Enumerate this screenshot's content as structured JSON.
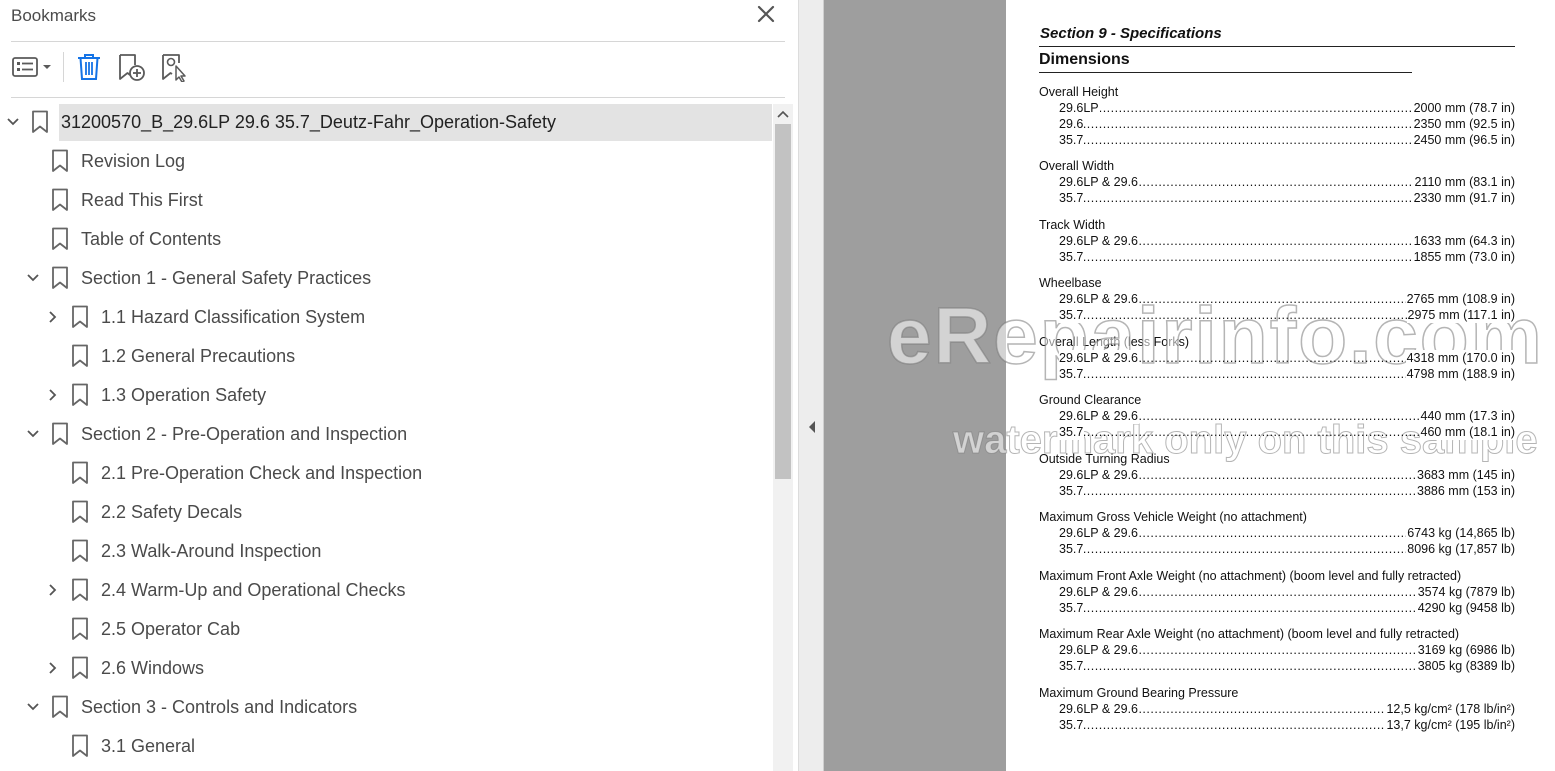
{
  "panel": {
    "title": "Bookmarks",
    "close_icon": "close-icon"
  },
  "toolbar": {
    "options_icon": "options-menu-icon",
    "delete_icon": "trash-icon",
    "new_bookmark_icon": "add-bookmark-icon",
    "bookmark_search_icon": "find-bookmark-icon"
  },
  "bookmarks": [
    {
      "label": "31200570_B_29.6LP 29.6 35.7_Deutz-Fahr_Operation-Safety",
      "level": 0,
      "chevron": "down",
      "selected": true
    },
    {
      "label": "Revision Log",
      "level": 1,
      "chevron": "none"
    },
    {
      "label": "Read This First",
      "level": 1,
      "chevron": "none"
    },
    {
      "label": "Table of Contents",
      "level": 1,
      "chevron": "none"
    },
    {
      "label": "Section 1 - General Safety Practices",
      "level": 1,
      "chevron": "down"
    },
    {
      "label": "1.1 Hazard Classification System",
      "level": 2,
      "chevron": "right"
    },
    {
      "label": "1.2 General Precautions",
      "level": 2,
      "chevron": "none"
    },
    {
      "label": "1.3 Operation Safety",
      "level": 2,
      "chevron": "right"
    },
    {
      "label": "Section 2 - Pre-Operation and Inspection",
      "level": 1,
      "chevron": "down"
    },
    {
      "label": "2.1 Pre-Operation Check and Inspection",
      "level": 2,
      "chevron": "none"
    },
    {
      "label": "2.2 Safety Decals",
      "level": 2,
      "chevron": "none"
    },
    {
      "label": "2.3 Walk-Around Inspection",
      "level": 2,
      "chevron": "none"
    },
    {
      "label": "2.4 Warm-Up and Operational Checks",
      "level": 2,
      "chevron": "right"
    },
    {
      "label": "2.5 Operator Cab",
      "level": 2,
      "chevron": "none"
    },
    {
      "label": "2.6 Windows",
      "level": 2,
      "chevron": "right"
    },
    {
      "label": "Section 3 - Controls and Indicators",
      "level": 1,
      "chevron": "down"
    },
    {
      "label": "3.1 General",
      "level": 2,
      "chevron": "none"
    }
  ],
  "document": {
    "section_title": "Section 9 - Specifications",
    "heading": "Dimensions",
    "groups": [
      {
        "title": "Overall Height",
        "rows": [
          {
            "model": "29.6LP",
            "value": "2000 mm (78.7 in)"
          },
          {
            "model": "29.6",
            "value": "2350 mm (92.5 in)"
          },
          {
            "model": "35.7",
            "value": "2450 mm (96.5 in)"
          }
        ]
      },
      {
        "title": "Overall Width",
        "rows": [
          {
            "model": "29.6LP & 29.6",
            "value": "2110 mm (83.1 in)"
          },
          {
            "model": "35.7",
            "value": "2330 mm (91.7 in)"
          }
        ]
      },
      {
        "title": "Track Width",
        "rows": [
          {
            "model": "29.6LP & 29.6",
            "value": "1633 mm (64.3 in)"
          },
          {
            "model": "35.7",
            "value": "1855 mm (73.0 in)"
          }
        ]
      },
      {
        "title": "Wheelbase",
        "rows": [
          {
            "model": "29.6LP & 29.6",
            "value": "2765 mm (108.9 in)"
          },
          {
            "model": "35.7",
            "value": "2975 mm (117.1 in)"
          }
        ]
      },
      {
        "title": "Overall Length (less Forks)",
        "rows": [
          {
            "model": "29.6LP & 29.6",
            "value": "4318 mm (170.0 in)"
          },
          {
            "model": "35.7",
            "value": "4798 mm (188.9 in)"
          }
        ]
      },
      {
        "title": "Ground Clearance",
        "rows": [
          {
            "model": "29.6LP & 29.6",
            "value": "440 mm (17.3 in)"
          },
          {
            "model": "35.7",
            "value": "460 mm (18.1 in)"
          }
        ]
      },
      {
        "title": "Outside Turning Radius",
        "rows": [
          {
            "model": "29.6LP & 29.6",
            "value": "3683 mm (145 in)"
          },
          {
            "model": "35.7",
            "value": "3886 mm (153 in)"
          }
        ]
      },
      {
        "title": "Maximum Gross Vehicle Weight (no attachment)",
        "rows": [
          {
            "model": "29.6LP & 29.6",
            "value": "6743 kg (14,865 lb)"
          },
          {
            "model": "35.7",
            "value": "8096 kg (17,857 lb)"
          }
        ]
      },
      {
        "title": "Maximum Front Axle Weight (no attachment) (boom level and fully retracted)",
        "rows": [
          {
            "model": "29.6LP & 29.6",
            "value": "3574 kg (7879 lb)"
          },
          {
            "model": "35.7",
            "value": "4290 kg (9458 lb)"
          }
        ]
      },
      {
        "title": "Maximum Rear Axle Weight (no attachment) (boom level and fully retracted)",
        "rows": [
          {
            "model": "29.6LP & 29.6",
            "value": "3169 kg (6986 lb)"
          },
          {
            "model": "35.7",
            "value": "3805 kg (8389 lb)"
          }
        ]
      },
      {
        "title": "Maximum Ground Bearing Pressure",
        "rows": [
          {
            "model": "29.6LP & 29.6",
            "value": "12,5 kg/cm² (178 lb/in²)"
          },
          {
            "model": "35.7",
            "value": "13,7 kg/cm² (195 lb/in²)"
          }
        ]
      }
    ]
  },
  "watermark": {
    "line1": "eRepairinfo.com",
    "line2": "watermark only on this sample"
  },
  "colors": {
    "selected_row": "#e3e3e3",
    "doc_background": "#9e9e9e",
    "icon": "#5a5a5a",
    "accent_icon": "#1473e6"
  }
}
